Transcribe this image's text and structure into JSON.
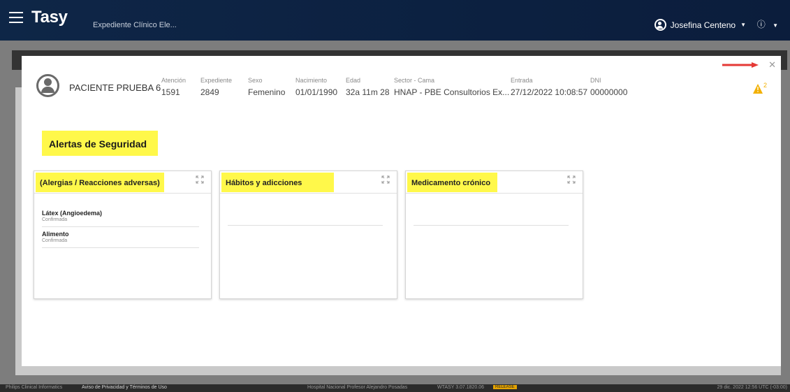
{
  "header": {
    "app_title": "Tasy",
    "subtitle": "Expediente Clínico Ele...",
    "user_name": "Josefina Centeno",
    "info_symbol": "ⓘ"
  },
  "patient": {
    "name": "PACIENTE PRUEBA 6",
    "fields": [
      {
        "label": "Atención",
        "value": "1591"
      },
      {
        "label": "Expediente",
        "value": "2849"
      },
      {
        "label": "Sexo",
        "value": "Femenino"
      },
      {
        "label": "Nacimiento",
        "value": "01/01/1990"
      },
      {
        "label": "Edad",
        "value": "32a 11m 28"
      },
      {
        "label": "Sector - Cama",
        "value": "HNAP - PBE Consultorios Ex..."
      },
      {
        "label": "Entrada",
        "value": "27/12/2022 10:08:57"
      },
      {
        "label": "DNI",
        "value": "00000000"
      }
    ],
    "warning_count": "2"
  },
  "alerts": {
    "title": "Alertas de Seguridad",
    "cards": [
      {
        "title": "(Alergias / Reacciones adversas)",
        "items": [
          {
            "name": "Látex (Angioedema)",
            "status": "Confirmada"
          },
          {
            "name": "Alimento",
            "status": "Confirmada"
          }
        ]
      },
      {
        "title": "Hábitos y adicciones",
        "items": []
      },
      {
        "title": "Medicamento crónico",
        "items": []
      }
    ]
  },
  "footer": {
    "company": "Philips Clinical Informatics",
    "privacy": "Aviso de Privacidad y Términos de Uso",
    "hospital": "Hospital Nacional Profesor Alejandro Posadas",
    "version": "WTASY 3.07.1820.06",
    "badge": "RELEASE",
    "datetime": "29 dic. 2022 12:56 UTC (-03:00)"
  },
  "colors": {
    "highlight": "#fff84a",
    "topbar": "#0e2647",
    "arrow": "#e53935"
  }
}
